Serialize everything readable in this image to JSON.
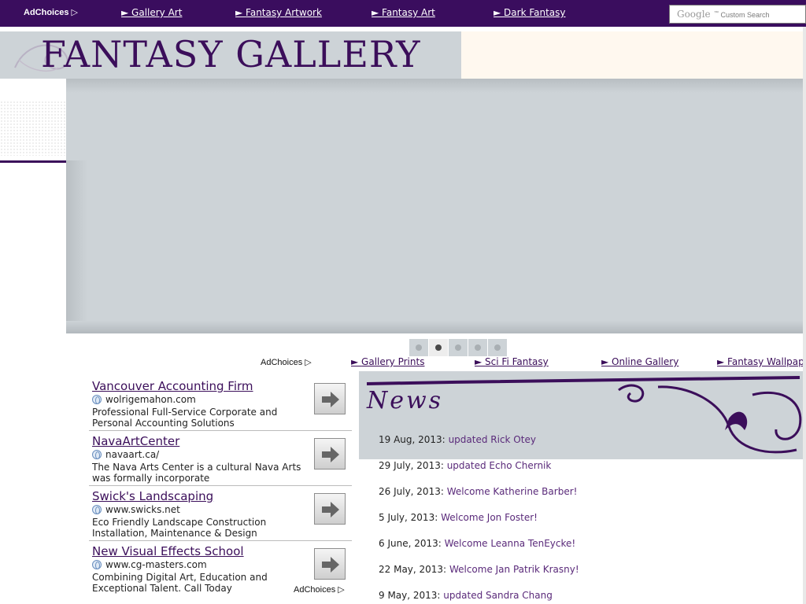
{
  "topbar": {
    "adchoices": "AdChoices",
    "links": [
      "Gallery Art",
      "Fantasy Artwork",
      "Fantasy Art",
      "Dark Fantasy"
    ],
    "search_brand": "Google",
    "search_label": "Custom Search"
  },
  "header": {
    "title": "FANTASY GALLERY"
  },
  "slider": {
    "dot_count": 5,
    "active_dot": 2
  },
  "linkbar2": {
    "adchoices": "AdChoices",
    "links": [
      "Gallery Prints",
      "Sci Fi Fantasy",
      "Online Gallery",
      "Fantasy Wallpap"
    ]
  },
  "ads": [
    {
      "title": "Vancouver Accounting Firm",
      "url": "wolrigemahon.com",
      "desc": "Professional Full-Service Corporate and Personal Accounting Solutions"
    },
    {
      "title": "NavaArtCenter",
      "url": "navaart.ca/",
      "desc": "The Nava Arts Center is a cultural Nava Arts was formally incorporate"
    },
    {
      "title": "Swick's Landscaping",
      "url": "www.swicks.net",
      "desc": "Eco Friendly Landscape Construction Installation, Maintenance & Design"
    },
    {
      "title": "New Visual Effects School",
      "url": "www.cg-masters.com",
      "desc": "Combining Digital Art, Education and Exceptional Talent. Call Today"
    }
  ],
  "ads_adchoices": "AdChoices",
  "news": {
    "title": "News",
    "items": [
      {
        "date": "19 Aug, 2013:",
        "text": "updated Rick Otey"
      },
      {
        "date": "29 July, 2013:",
        "text": "updated Echo Chernik"
      },
      {
        "date": "26 July, 2013:",
        "text": "Welcome Katherine Barber!"
      },
      {
        "date": "5 July, 2013:",
        "text": "Welcome Jon Foster!"
      },
      {
        "date": "6 June, 2013:",
        "text": "Welcome Leanna TenEycke!"
      },
      {
        "date": "22 May, 2013:",
        "text": "Welcome Jan Patrik Krasny!"
      },
      {
        "date": "9 May, 2013:",
        "text": "updated Sandra Chang"
      }
    ]
  }
}
